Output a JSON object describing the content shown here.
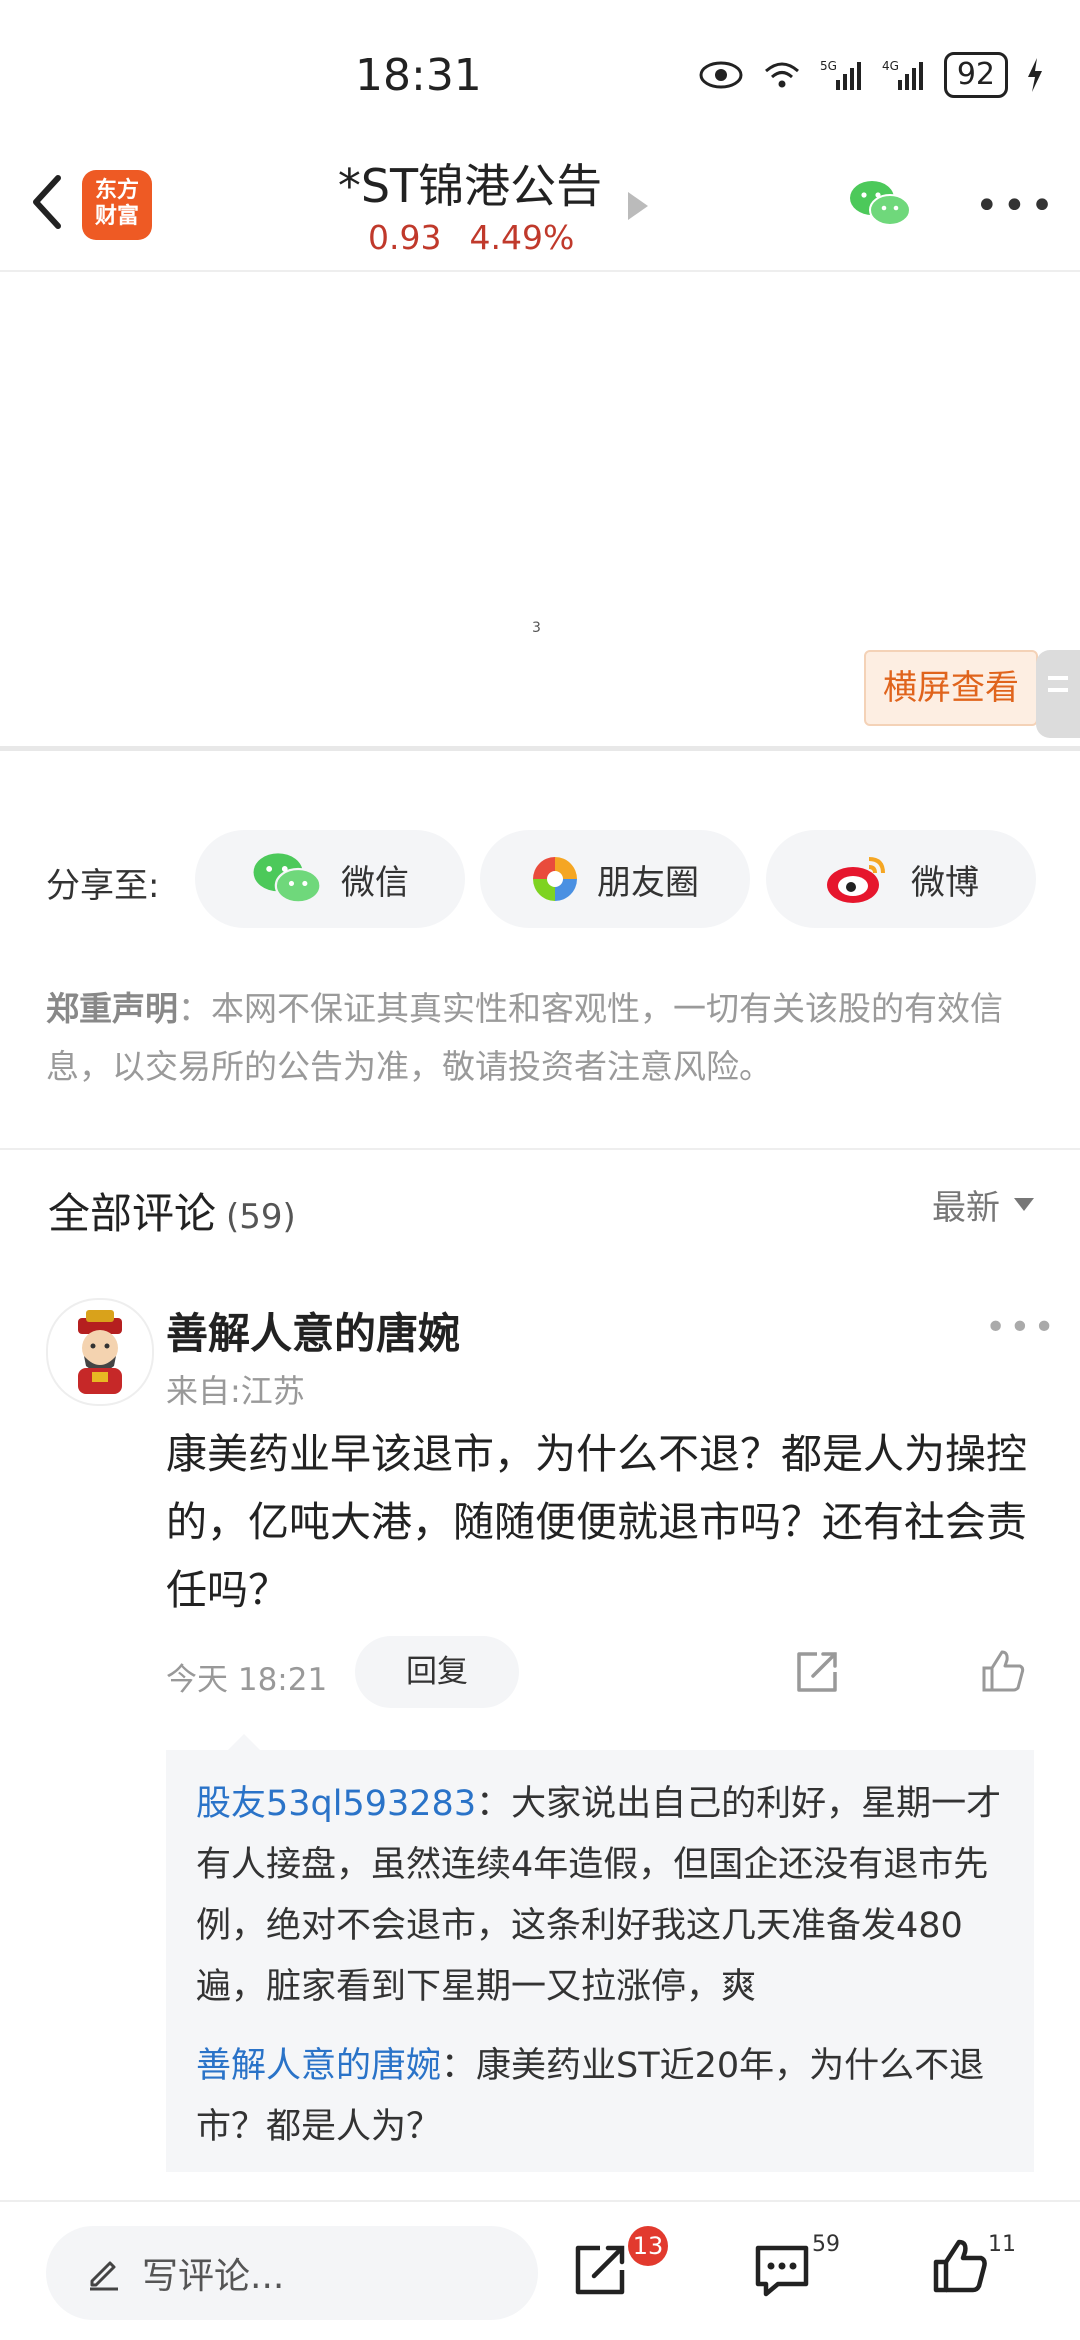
{
  "status_bar": {
    "time": "18:31",
    "battery": "92"
  },
  "header": {
    "title": "*ST锦港公告",
    "price": "0.93",
    "change": "4.49%",
    "logo_line1": "东方",
    "logo_line2": "财富"
  },
  "pdf": {
    "page_number": "3",
    "landscape_label": "横屏查看"
  },
  "share": {
    "label": "分享至:",
    "wechat": "微信",
    "moments": "朋友圈",
    "weibo": "微博"
  },
  "disclaimer": {
    "title": "郑重声明",
    "text": "：本网不保证其真实性和客观性，一切有关该股的有效信息，以交易所的公告为准，敬请投资者注意风险。"
  },
  "comments": {
    "title": "全部评论",
    "count": "(59)",
    "sort_label": "最新",
    "items": [
      {
        "username": "善解人意的唐婉",
        "location": "来自:江苏",
        "text": "康美药业早该退市，为什么不退？都是人为操控的，亿吨大港，随随便便就退市吗？还有社会责任吗？",
        "time": "今天 18:21",
        "reply_label": "回复",
        "replies": [
          {
            "author": "股友53ql593283",
            "text": "：大家说出自己的利好，星期一才有人接盘，虽然连续4年造假，但国企还没有退市先例，绝对不会退市，这条利好我这几天准备发480遍，脏家看到下星期一又拉涨停，爽"
          },
          {
            "author": "善解人意的唐婉",
            "text": "：康美药业ST近20年，为什么不退市？都是人为？"
          }
        ]
      }
    ]
  },
  "bottom_bar": {
    "write_placeholder": "写评论...",
    "share_badge": "13",
    "comment_count": "59",
    "like_count": "11"
  },
  "colors": {
    "accent_red": "#c0392b",
    "link_blue": "#2a73c8",
    "orange": "#e0641c"
  }
}
